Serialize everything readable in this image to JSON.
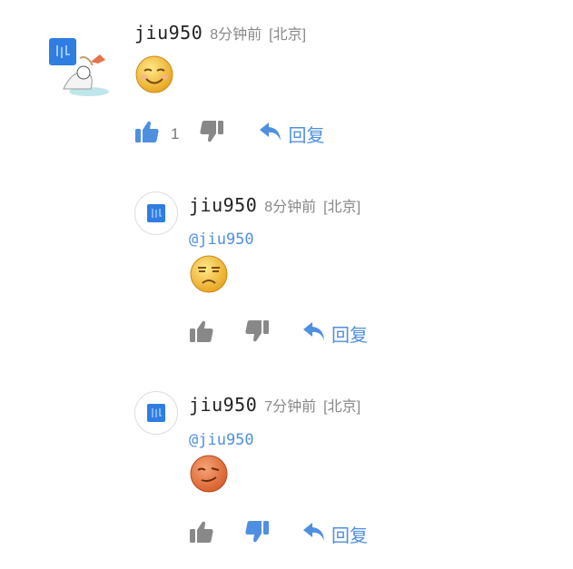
{
  "comments": [
    {
      "username": "jiu950",
      "time": "8分钟前",
      "location": "[北京]",
      "emoji": "smile-emoji",
      "like_count": "1",
      "reply_label": "回复"
    },
    {
      "username": "jiu950",
      "time": "8分钟前",
      "location": "[北京]",
      "mention": "@jiu950",
      "emoji": "unhappy-emoji",
      "reply_label": "回复"
    },
    {
      "username": "jiu950",
      "time": "7分钟前",
      "location": "[北京]",
      "mention": "@jiu950",
      "emoji": "smirk-emoji",
      "reply_label": "回复"
    }
  ],
  "colors": {
    "accent": "#4f8fe0",
    "icon_gray": "#888888",
    "text": "#222222",
    "meta": "#888888"
  },
  "icons": [
    "thumbs-up-icon",
    "thumbs-down-icon",
    "reply-arrow-icon"
  ]
}
